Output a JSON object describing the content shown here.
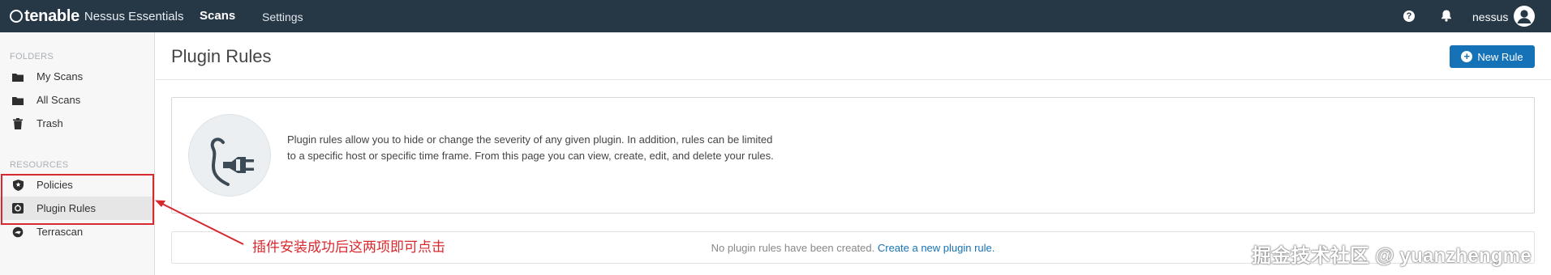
{
  "topbar": {
    "brand": "tenable",
    "product": "Nessus Essentials",
    "nav_scans": "Scans",
    "nav_settings": "Settings",
    "help_icon": "?",
    "username": "nessus"
  },
  "sidebar": {
    "folders_label": "FOLDERS",
    "resources_label": "RESOURCES",
    "folders": [
      {
        "label": "My Scans",
        "icon": "folder-icon"
      },
      {
        "label": "All Scans",
        "icon": "folder-icon"
      },
      {
        "label": "Trash",
        "icon": "trash-icon"
      }
    ],
    "resources": [
      {
        "label": "Policies",
        "icon": "shield-star-icon"
      },
      {
        "label": "Plugin Rules",
        "icon": "plugin-rules-icon",
        "active": true
      },
      {
        "label": "Terrascan",
        "icon": "terrascan-icon"
      }
    ]
  },
  "main": {
    "title": "Plugin Rules",
    "new_rule_label": "New Rule",
    "info_text": "Plugin rules allow you to hide or change the severity of any given plugin. In addition, rules can be limited to a specific host or specific time frame. From this page you can view, create, edit, and delete your rules.",
    "empty_text": "No plugin rules have been created.",
    "empty_link": "Create a new plugin rule."
  },
  "annotation": {
    "text": "插件安装成功后这两项即可点击",
    "color": "#d8292f"
  },
  "watermark": "掘金技术社区 @ yuanzhengme",
  "colors": {
    "topbar": "#263746",
    "accent": "#1572b6"
  }
}
